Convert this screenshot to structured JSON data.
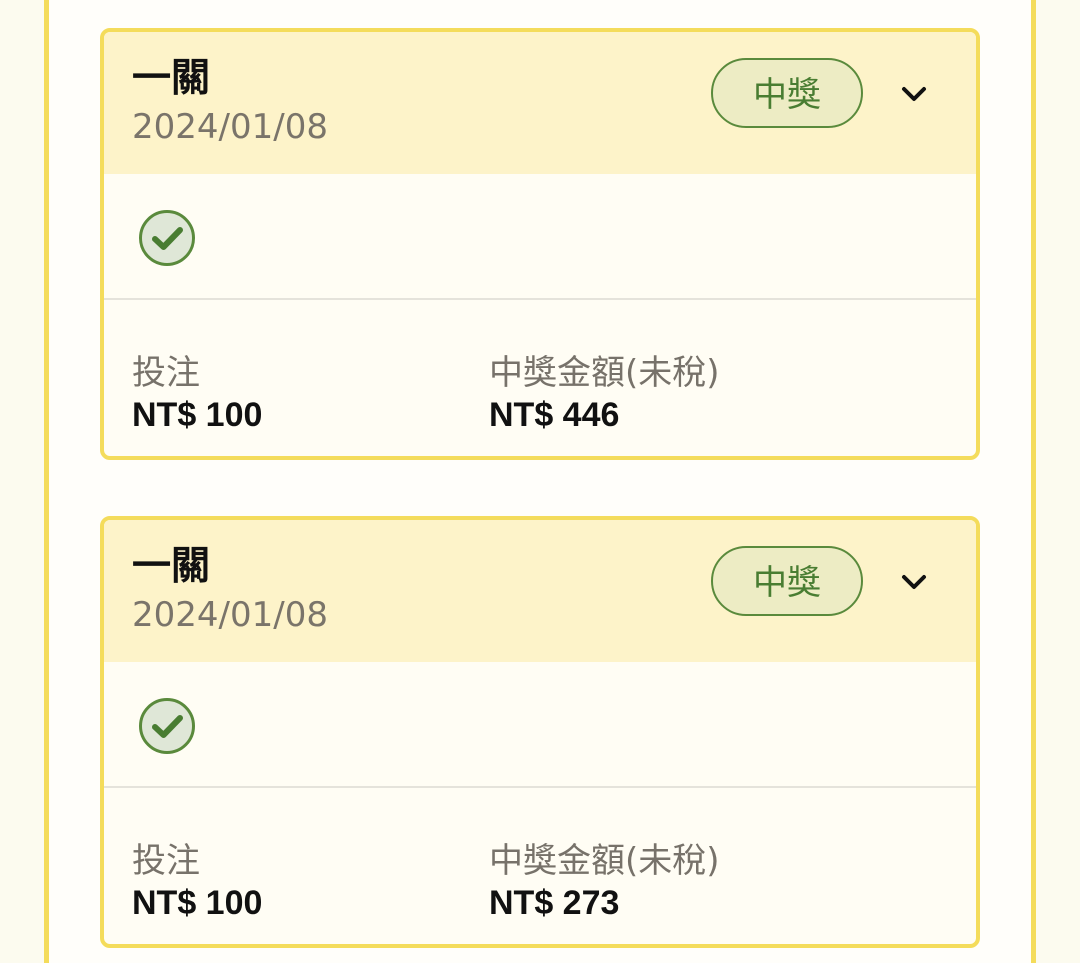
{
  "colors": {
    "page_background": "#fcfbef",
    "panel_border": "#f4dc5b",
    "header_background": "#fdf3c9",
    "win_badge_text": "#497d32",
    "win_badge_background": "#edecc4",
    "check_green": "#4f8332"
  },
  "cards": [
    {
      "title": "一關",
      "date": "2024/01/08",
      "status_badge": "中獎",
      "expand_icon": "chevron-down-icon",
      "result_icon": "check-circle-icon",
      "bet_label": "投注",
      "bet_amount": "NT$ 100",
      "prize_label": "中獎金額(未稅)",
      "prize_amount": "NT$ 446"
    },
    {
      "title": "一關",
      "date": "2024/01/08",
      "status_badge": "中獎",
      "expand_icon": "chevron-down-icon",
      "result_icon": "check-circle-icon",
      "bet_label": "投注",
      "bet_amount": "NT$ 100",
      "prize_label": "中獎金額(未稅)",
      "prize_amount": "NT$ 273"
    }
  ]
}
